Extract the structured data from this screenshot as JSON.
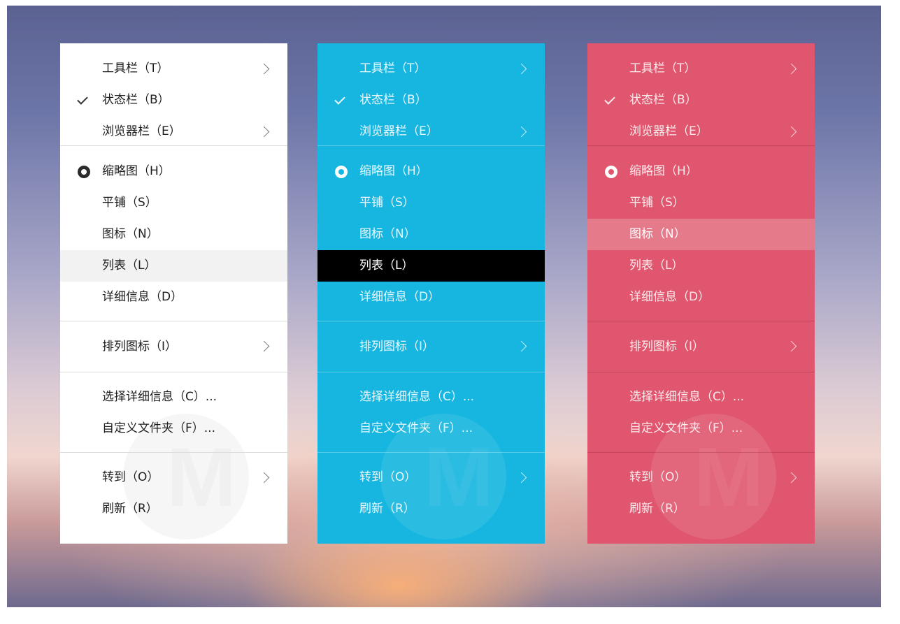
{
  "menu_items": {
    "toolbar": "工具栏（T）",
    "statusbar": "状态栏（B）",
    "browserbar": "浏览器栏（E）",
    "thumbnails": "缩略图（H）",
    "tiles": "平铺（S）",
    "icons": "图标（N）",
    "list": "列表（L）",
    "details": "详细信息（D）",
    "arrange_icons": "排列图标（I）",
    "choose_details": "选择详细信息（C）...",
    "customize_folder": "自定义文件夹（F）...",
    "go_to": "转到（O）",
    "refresh": "刷新（R）"
  },
  "themes": [
    {
      "name": "white",
      "background": "#ffffff",
      "highlighted_item": "列表（L）",
      "highlight_color": "#f2f2f2"
    },
    {
      "name": "blue",
      "background": "#17b6e0",
      "highlighted_item": "列表（L）",
      "highlight_color": "#000000"
    },
    {
      "name": "red",
      "background": "#e0566e",
      "highlighted_item": "图标（N）",
      "highlight_color": "#e57a8b"
    }
  ],
  "checked_item": "状态栏（B）",
  "selected_view": "缩略图（H）",
  "icons": {
    "check": "check-icon",
    "radio": "radio-selected-icon",
    "submenu": "chevron-right-icon"
  }
}
